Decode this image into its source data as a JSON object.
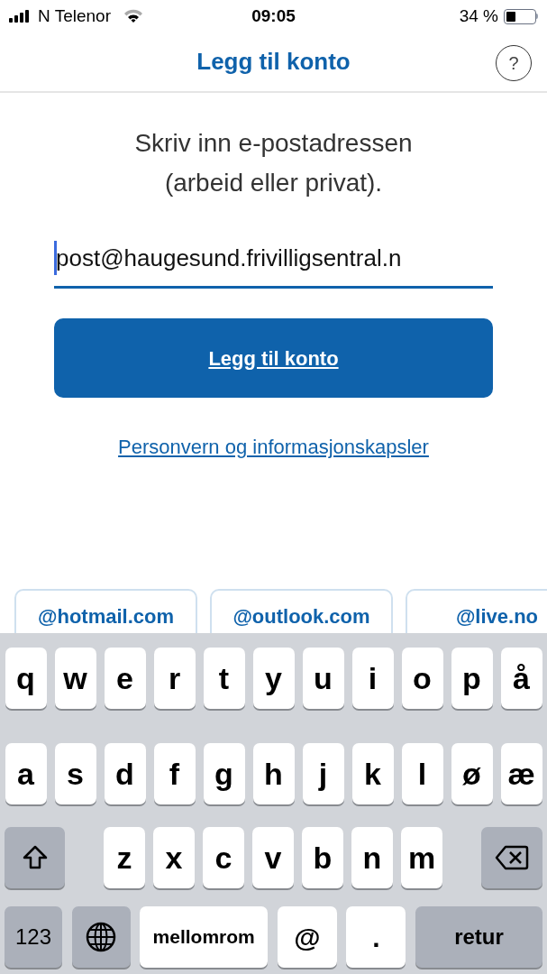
{
  "status_bar": {
    "carrier": "N Telenor",
    "time": "09:05",
    "battery": "34 %"
  },
  "nav": {
    "title": "Legg til konto",
    "help": "?"
  },
  "prompt": "Skriv inn e-postadressen (arbeid eller privat).",
  "email_field": {
    "value": "post@haugesund.frivilligsentral.n",
    "focused": true
  },
  "primary_button": "Legg til konto",
  "privacy_link": "Personvern og informasjonskapsler",
  "suggestions": [
    "@hotmail.com",
    "@outlook.com",
    "@live.no"
  ],
  "keyboard": [
    [
      {
        "kind": "letter",
        "label": "q"
      },
      {
        "kind": "letter",
        "label": "w"
      },
      {
        "kind": "letter",
        "label": "e"
      },
      {
        "kind": "letter",
        "label": "r"
      },
      {
        "kind": "letter",
        "label": "t"
      },
      {
        "kind": "letter",
        "label": "y"
      },
      {
        "kind": "letter",
        "label": "u"
      },
      {
        "kind": "letter",
        "label": "i"
      },
      {
        "kind": "letter",
        "label": "o"
      },
      {
        "kind": "letter",
        "label": "p"
      },
      {
        "kind": "letter",
        "label": "å"
      }
    ],
    [
      {
        "kind": "letter",
        "label": "a"
      },
      {
        "kind": "letter",
        "label": "s"
      },
      {
        "kind": "letter",
        "label": "d"
      },
      {
        "kind": "letter",
        "label": "f"
      },
      {
        "kind": "letter",
        "label": "g"
      },
      {
        "kind": "letter",
        "label": "h"
      },
      {
        "kind": "letter",
        "label": "j"
      },
      {
        "kind": "letter",
        "label": "k"
      },
      {
        "kind": "letter",
        "label": "l"
      },
      {
        "kind": "letter",
        "label": "ø"
      },
      {
        "kind": "letter",
        "label": "æ"
      }
    ],
    [
      {
        "kind": "shift"
      },
      {
        "kind": "letter",
        "label": "z"
      },
      {
        "kind": "letter",
        "label": "x"
      },
      {
        "kind": "letter",
        "label": "c"
      },
      {
        "kind": "letter",
        "label": "v"
      },
      {
        "kind": "letter",
        "label": "b"
      },
      {
        "kind": "letter",
        "label": "n"
      },
      {
        "kind": "letter",
        "label": "m"
      },
      {
        "kind": "backspace"
      }
    ],
    [
      {
        "kind": "numbers",
        "label": "123"
      },
      {
        "kind": "globe"
      },
      {
        "kind": "space",
        "label": "mellomrom"
      },
      {
        "kind": "symbol",
        "label": "@"
      },
      {
        "kind": "symbol",
        "label": "."
      },
      {
        "kind": "return",
        "label": "retur"
      }
    ]
  ]
}
